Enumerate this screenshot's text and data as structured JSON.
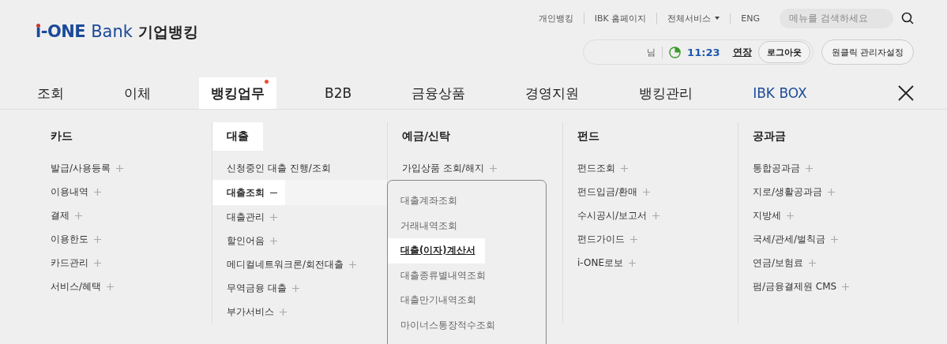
{
  "logo": {
    "brand_bold": "i-ONE",
    "brand": "Bank",
    "service": "기업뱅킹"
  },
  "top_links": [
    {
      "label": "개인뱅킹",
      "kind": "link"
    },
    {
      "label": "IBK 홈페이지",
      "kind": "link"
    },
    {
      "label": "전체서비스",
      "kind": "dropdown"
    },
    {
      "label": "ENG",
      "kind": "link"
    }
  ],
  "search": {
    "placeholder": "메뉴를 검색하세요"
  },
  "session": {
    "name_suffix": "님",
    "remaining_time": "11:23",
    "extend": "연장",
    "logout": "로그아웃"
  },
  "admin_button": "원클릭 관리자설정",
  "tabs": [
    {
      "label": "조회",
      "selected": false,
      "badge": false,
      "kind": "normal"
    },
    {
      "label": "이체",
      "selected": false,
      "badge": false,
      "kind": "normal"
    },
    {
      "label": "뱅킹업무",
      "selected": true,
      "badge": true,
      "kind": "normal"
    },
    {
      "label": "B2B",
      "selected": false,
      "badge": false,
      "kind": "normal"
    },
    {
      "label": "금융상품",
      "selected": false,
      "badge": false,
      "kind": "normal"
    },
    {
      "label": "경영지원",
      "selected": false,
      "badge": false,
      "kind": "normal"
    },
    {
      "label": "뱅킹관리",
      "selected": false,
      "badge": false,
      "kind": "normal"
    },
    {
      "label": "IBK BOX",
      "selected": false,
      "badge": false,
      "kind": "brand"
    }
  ],
  "menu_columns": [
    {
      "title": "카드",
      "selected": false,
      "items": [
        {
          "label": "발급/사용등록",
          "expandable": true,
          "expanded": false,
          "selected": false
        },
        {
          "label": "이용내역",
          "expandable": true,
          "expanded": false,
          "selected": false
        },
        {
          "label": "결제",
          "expandable": true,
          "expanded": false,
          "selected": false
        },
        {
          "label": "이용한도",
          "expandable": true,
          "expanded": false,
          "selected": false
        },
        {
          "label": "카드관리",
          "expandable": true,
          "expanded": false,
          "selected": false
        },
        {
          "label": "서비스/혜택",
          "expandable": true,
          "expanded": false,
          "selected": false
        }
      ]
    },
    {
      "title": "대출",
      "selected": true,
      "items": [
        {
          "label": "신청중인 대출 진행/조회",
          "expandable": false,
          "selected": false
        },
        {
          "label": "대출조회",
          "expandable": true,
          "expanded": true,
          "selected": true,
          "children": [
            {
              "label": "대출계좌조회",
              "selected": false
            },
            {
              "label": "거래내역조회",
              "selected": false
            },
            {
              "label": "대출(이자)계산서",
              "selected": true
            },
            {
              "label": "대출종류별내역조회",
              "selected": false
            },
            {
              "label": "대출만기내역조회",
              "selected": false
            },
            {
              "label": "마이너스통장적수조회",
              "selected": false
            }
          ]
        },
        {
          "label": "대출관리",
          "expandable": true,
          "expanded": false,
          "selected": false
        },
        {
          "label": "할인어음",
          "expandable": true,
          "expanded": false,
          "selected": false
        },
        {
          "label": "메디컬네트워크론/회전대출",
          "expandable": true,
          "expanded": false,
          "selected": false
        },
        {
          "label": "무역금융 대출",
          "expandable": true,
          "expanded": false,
          "selected": false
        },
        {
          "label": "부가서비스",
          "expandable": true,
          "expanded": false,
          "selected": false
        }
      ]
    },
    {
      "title": "예금/신탁",
      "selected": false,
      "items": [
        {
          "label": "가입상품 조회/해지",
          "expandable": true,
          "expanded": false,
          "selected": false
        }
      ]
    },
    {
      "title": "펀드",
      "selected": false,
      "items": [
        {
          "label": "펀드조회",
          "expandable": true,
          "expanded": false,
          "selected": false
        },
        {
          "label": "펀드입금/환매",
          "expandable": true,
          "expanded": false,
          "selected": false
        },
        {
          "label": "수시공시/보고서",
          "expandable": true,
          "expanded": false,
          "selected": false
        },
        {
          "label": "펀드가이드",
          "expandable": true,
          "expanded": false,
          "selected": false
        },
        {
          "label": "i-ONE로보",
          "expandable": true,
          "expanded": false,
          "selected": false
        }
      ]
    },
    {
      "title": "공과금",
      "selected": false,
      "items": [
        {
          "label": "통합공과금",
          "expandable": true,
          "expanded": false,
          "selected": false
        },
        {
          "label": "지로/생활공과금",
          "expandable": true,
          "expanded": false,
          "selected": false
        },
        {
          "label": "지방세",
          "expandable": true,
          "expanded": false,
          "selected": false
        },
        {
          "label": "국세/관세/벌칙금",
          "expandable": true,
          "expanded": false,
          "selected": false
        },
        {
          "label": "연금/보험료",
          "expandable": true,
          "expanded": false,
          "selected": false
        },
        {
          "label": "펌/금융결제원 CMS",
          "expandable": true,
          "expanded": false,
          "selected": false
        }
      ]
    }
  ]
}
